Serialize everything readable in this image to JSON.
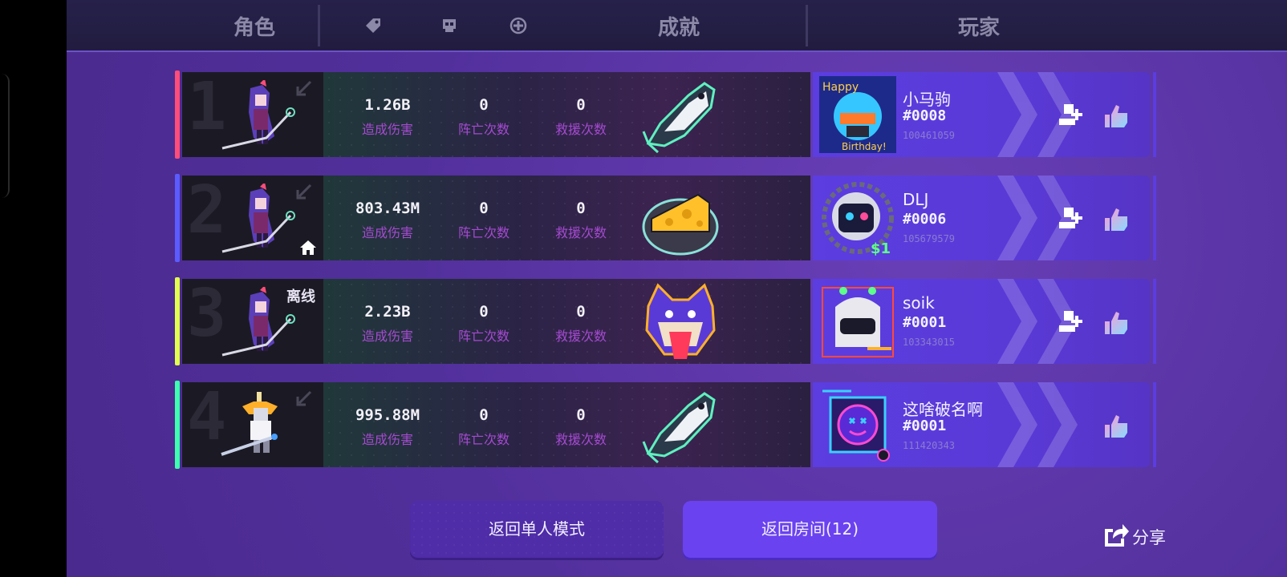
{
  "header": {
    "col_character": "角色",
    "col_achievement": "成就",
    "col_player": "玩家",
    "icons": [
      "tag-icon",
      "skull-icon",
      "crosshair-plus-icon"
    ]
  },
  "rows": [
    {
      "rank": "1",
      "accent_color": "#ff4d7a",
      "character_icon": "character-sprite-icon",
      "status_icon": "arrow-down-left-icon",
      "damage": "1.26B",
      "damage_label": "造成伤害",
      "deaths": "0",
      "deaths_label": "阵亡次数",
      "rescues": "0",
      "rescues_label": "救援次数",
      "achievement_icon": "fish-icon",
      "player": {
        "name": "小马驹",
        "tag": "#0008",
        "id": "100461059",
        "avatar_icon": "birthday-robot-avatar-icon"
      }
    },
    {
      "rank": "2",
      "accent_color": "#5a5cff",
      "character_icon": "character-sprite-icon",
      "status_icon": "arrow-down-left-icon",
      "host_icon": "home-icon",
      "damage": "803.43M",
      "damage_label": "造成伤害",
      "deaths": "0",
      "deaths_label": "阵亡次数",
      "rescues": "0",
      "rescues_label": "救援次数",
      "achievement_icon": "cheese-icon",
      "player": {
        "name": "DLJ",
        "tag": "#0006",
        "id": "105679579",
        "avatar_icon": "astronaut-avatar-icon"
      }
    },
    {
      "rank": "3",
      "accent_color": "#e3ff4d",
      "character_icon": "character-sprite-icon",
      "offline_label": "离线",
      "damage": "2.23B",
      "damage_label": "造成伤害",
      "deaths": "0",
      "deaths_label": "阵亡次数",
      "rescues": "0",
      "rescues_label": "救援次数",
      "achievement_icon": "wolf-icon",
      "player": {
        "name": "soik",
        "tag": "#0001",
        "id": "103343015",
        "avatar_icon": "hooded-robot-avatar-icon"
      }
    },
    {
      "rank": "4",
      "accent_color": "#3dffb0",
      "character_icon": "knight-sprite-icon",
      "status_icon": "arrow-down-left-icon",
      "damage": "995.88M",
      "damage_label": "造成伤害",
      "deaths": "0",
      "deaths_label": "阵亡次数",
      "rescues": "0",
      "rescues_label": "救援次数",
      "achievement_icon": "fish-icon",
      "player": {
        "name": "这啥破名啊",
        "tag": "#0001",
        "id": "111420343",
        "avatar_icon": "neon-abyss-avatar-icon"
      }
    }
  ],
  "buttons": {
    "single_mode": "返回单人模式",
    "back_to_room": "返回房间(12)",
    "share": "分享"
  }
}
